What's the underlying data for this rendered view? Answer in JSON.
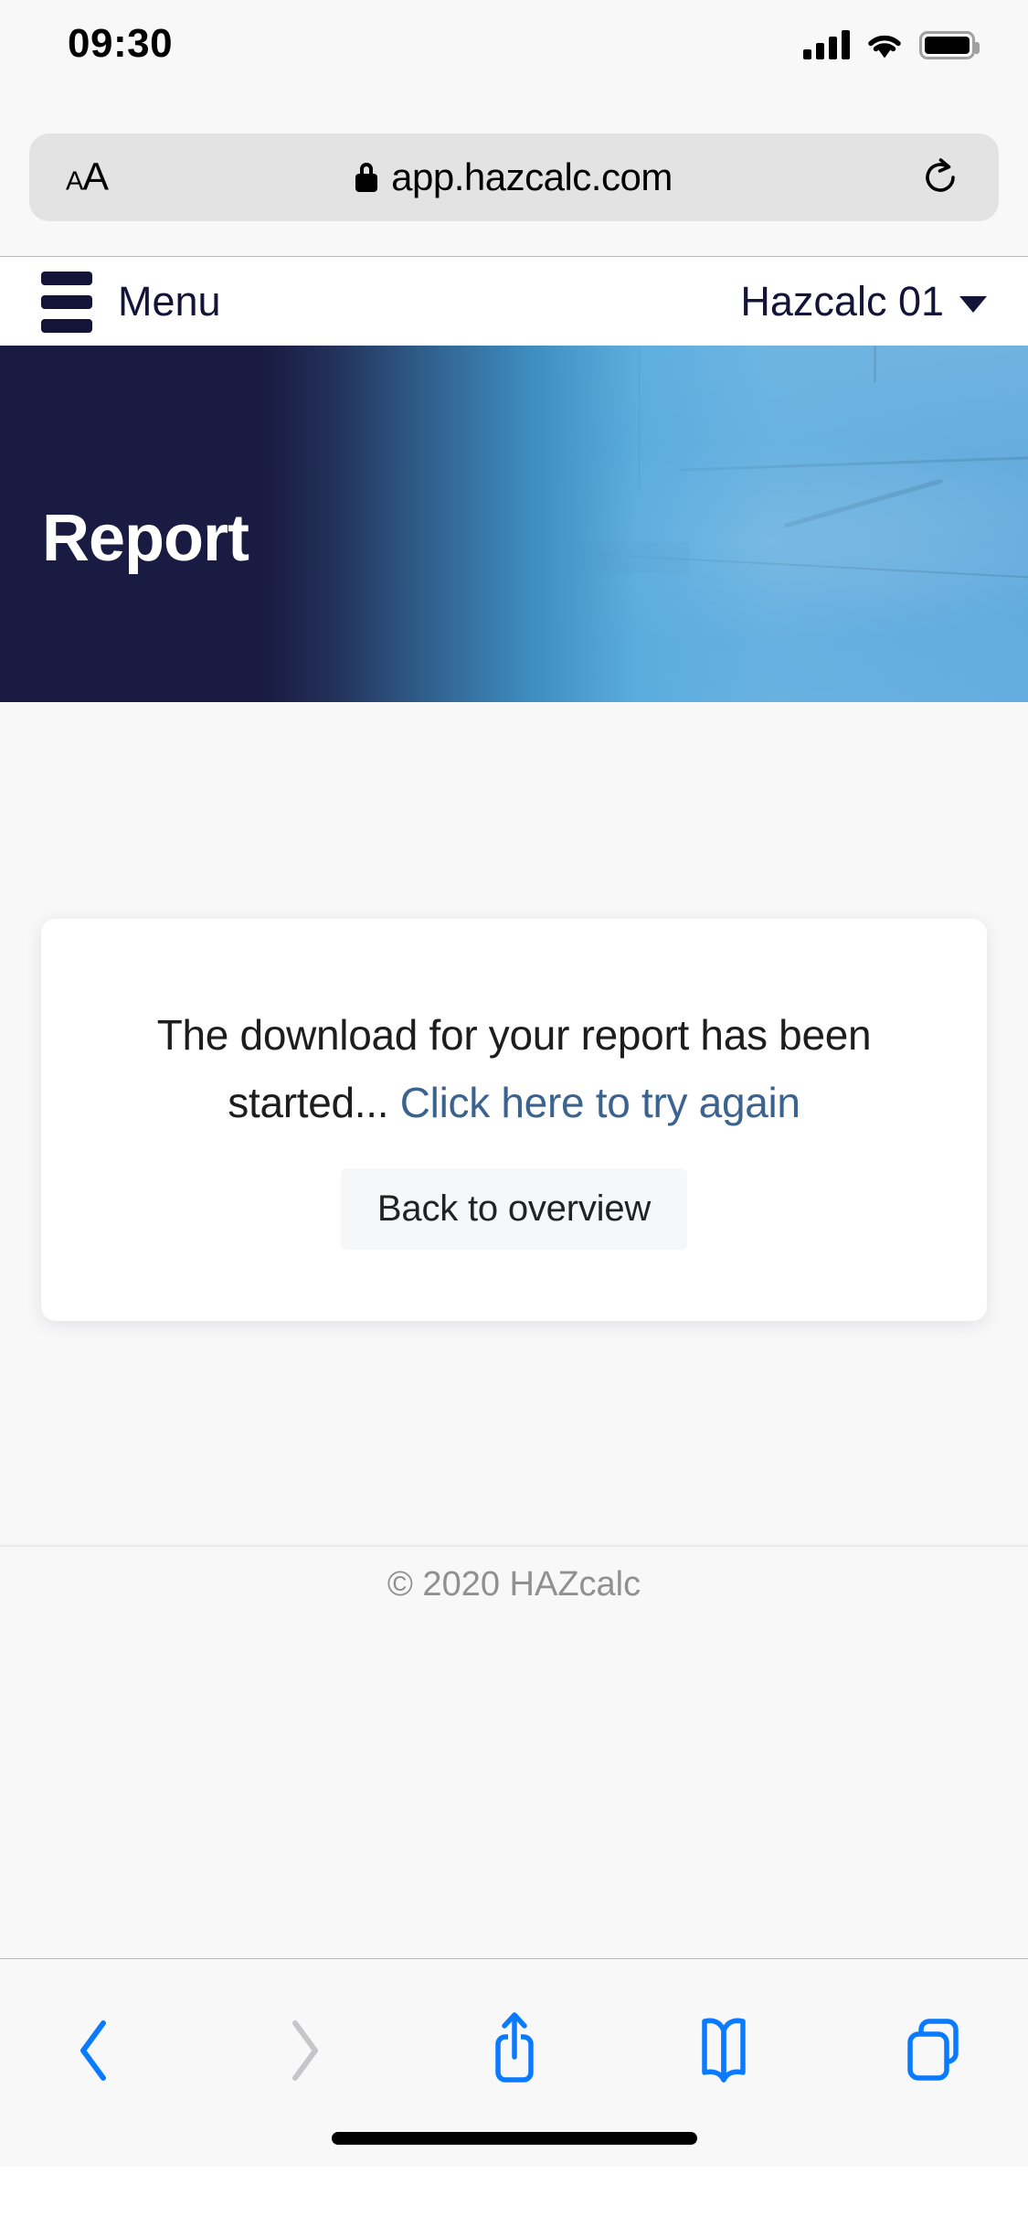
{
  "status_bar": {
    "time": "09:30",
    "signal_icon": "cellular-signal-icon",
    "wifi_icon": "wifi-icon",
    "battery_icon": "battery-full-icon"
  },
  "browser": {
    "text_size_button": {
      "small": "A",
      "large": "A"
    },
    "lock_icon": "lock-icon",
    "url": "app.hazcalc.com",
    "reload_icon": "reload-icon",
    "toolbar": {
      "back": "back-chevron-icon",
      "forward": "forward-chevron-icon",
      "share": "share-icon",
      "bookmarks": "book-icon",
      "tabs": "tabs-icon"
    }
  },
  "app": {
    "menu_label": "Menu",
    "menu_icon": "hamburger-icon",
    "project_name": "Hazcalc 01",
    "project_caret_icon": "chevron-down-icon",
    "hero_title": "Report",
    "card": {
      "message_prefix": "The download for your report has been started...",
      "retry_link": "Click here to try again",
      "back_button": "Back to overview"
    },
    "footer": {
      "copyright": "© 2020 HAZcalc"
    }
  },
  "colors": {
    "brand_dark": "#131438",
    "hero_dark": "#1a1b42",
    "hero_light": "#6fb3e0",
    "link_blue": "#3b6390",
    "safari_blue": "#0a7aff",
    "disabled_gray": "#c6c6c8"
  }
}
